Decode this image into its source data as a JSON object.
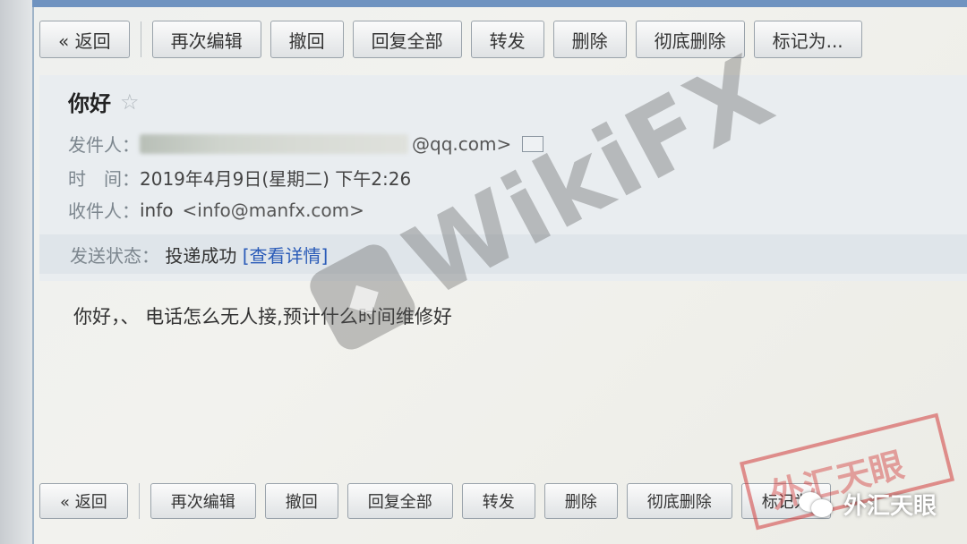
{
  "toolbar_top": {
    "buttons": [
      "« 返回",
      "再次编辑",
      "撤回",
      "回复全部",
      "转发",
      "删除",
      "彻底删除",
      "标记为..."
    ]
  },
  "toolbar_bottom": {
    "buttons": [
      "« 返回",
      "再次编辑",
      "撤回",
      "回复全部",
      "转发",
      "删除",
      "彻底删除",
      "标记为"
    ]
  },
  "email": {
    "subject": "你好",
    "sender_label": "发件人：",
    "sender_email_suffix": "@qq.com>",
    "time_label": "时　间：",
    "time_value": "2019年4月9日(星期二) 下午2:26",
    "recipient_label": "收件人：",
    "recipient_name": "info",
    "recipient_email": "<info@manfx.com>",
    "status_label": "发送状态：",
    "status_value": "投递成功",
    "status_link": "[查看详情]",
    "body": "你好，、 电话怎么无人接,预计什么时间维修好"
  },
  "watermark": {
    "text": "WikiFX"
  },
  "stamp": {
    "text": "外汇天眼"
  },
  "corner_brand": {
    "text": "外汇天眼"
  }
}
